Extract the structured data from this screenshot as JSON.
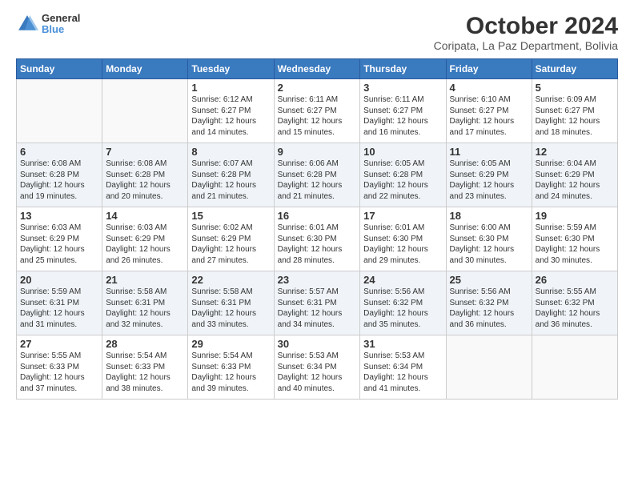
{
  "logo": {
    "text1": "General",
    "text2": "Blue"
  },
  "title": "October 2024",
  "subtitle": "Coripata, La Paz Department, Bolivia",
  "days_of_week": [
    "Sunday",
    "Monday",
    "Tuesday",
    "Wednesday",
    "Thursday",
    "Friday",
    "Saturday"
  ],
  "weeks": [
    [
      {
        "day": "",
        "info": ""
      },
      {
        "day": "",
        "info": ""
      },
      {
        "day": "1",
        "info": "Sunrise: 6:12 AM\nSunset: 6:27 PM\nDaylight: 12 hours and 14 minutes."
      },
      {
        "day": "2",
        "info": "Sunrise: 6:11 AM\nSunset: 6:27 PM\nDaylight: 12 hours and 15 minutes."
      },
      {
        "day": "3",
        "info": "Sunrise: 6:11 AM\nSunset: 6:27 PM\nDaylight: 12 hours and 16 minutes."
      },
      {
        "day": "4",
        "info": "Sunrise: 6:10 AM\nSunset: 6:27 PM\nDaylight: 12 hours and 17 minutes."
      },
      {
        "day": "5",
        "info": "Sunrise: 6:09 AM\nSunset: 6:27 PM\nDaylight: 12 hours and 18 minutes."
      }
    ],
    [
      {
        "day": "6",
        "info": "Sunrise: 6:08 AM\nSunset: 6:28 PM\nDaylight: 12 hours and 19 minutes."
      },
      {
        "day": "7",
        "info": "Sunrise: 6:08 AM\nSunset: 6:28 PM\nDaylight: 12 hours and 20 minutes."
      },
      {
        "day": "8",
        "info": "Sunrise: 6:07 AM\nSunset: 6:28 PM\nDaylight: 12 hours and 21 minutes."
      },
      {
        "day": "9",
        "info": "Sunrise: 6:06 AM\nSunset: 6:28 PM\nDaylight: 12 hours and 21 minutes."
      },
      {
        "day": "10",
        "info": "Sunrise: 6:05 AM\nSunset: 6:28 PM\nDaylight: 12 hours and 22 minutes."
      },
      {
        "day": "11",
        "info": "Sunrise: 6:05 AM\nSunset: 6:29 PM\nDaylight: 12 hours and 23 minutes."
      },
      {
        "day": "12",
        "info": "Sunrise: 6:04 AM\nSunset: 6:29 PM\nDaylight: 12 hours and 24 minutes."
      }
    ],
    [
      {
        "day": "13",
        "info": "Sunrise: 6:03 AM\nSunset: 6:29 PM\nDaylight: 12 hours and 25 minutes."
      },
      {
        "day": "14",
        "info": "Sunrise: 6:03 AM\nSunset: 6:29 PM\nDaylight: 12 hours and 26 minutes."
      },
      {
        "day": "15",
        "info": "Sunrise: 6:02 AM\nSunset: 6:29 PM\nDaylight: 12 hours and 27 minutes."
      },
      {
        "day": "16",
        "info": "Sunrise: 6:01 AM\nSunset: 6:30 PM\nDaylight: 12 hours and 28 minutes."
      },
      {
        "day": "17",
        "info": "Sunrise: 6:01 AM\nSunset: 6:30 PM\nDaylight: 12 hours and 29 minutes."
      },
      {
        "day": "18",
        "info": "Sunrise: 6:00 AM\nSunset: 6:30 PM\nDaylight: 12 hours and 30 minutes."
      },
      {
        "day": "19",
        "info": "Sunrise: 5:59 AM\nSunset: 6:30 PM\nDaylight: 12 hours and 30 minutes."
      }
    ],
    [
      {
        "day": "20",
        "info": "Sunrise: 5:59 AM\nSunset: 6:31 PM\nDaylight: 12 hours and 31 minutes."
      },
      {
        "day": "21",
        "info": "Sunrise: 5:58 AM\nSunset: 6:31 PM\nDaylight: 12 hours and 32 minutes."
      },
      {
        "day": "22",
        "info": "Sunrise: 5:58 AM\nSunset: 6:31 PM\nDaylight: 12 hours and 33 minutes."
      },
      {
        "day": "23",
        "info": "Sunrise: 5:57 AM\nSunset: 6:31 PM\nDaylight: 12 hours and 34 minutes."
      },
      {
        "day": "24",
        "info": "Sunrise: 5:56 AM\nSunset: 6:32 PM\nDaylight: 12 hours and 35 minutes."
      },
      {
        "day": "25",
        "info": "Sunrise: 5:56 AM\nSunset: 6:32 PM\nDaylight: 12 hours and 36 minutes."
      },
      {
        "day": "26",
        "info": "Sunrise: 5:55 AM\nSunset: 6:32 PM\nDaylight: 12 hours and 36 minutes."
      }
    ],
    [
      {
        "day": "27",
        "info": "Sunrise: 5:55 AM\nSunset: 6:33 PM\nDaylight: 12 hours and 37 minutes."
      },
      {
        "day": "28",
        "info": "Sunrise: 5:54 AM\nSunset: 6:33 PM\nDaylight: 12 hours and 38 minutes."
      },
      {
        "day": "29",
        "info": "Sunrise: 5:54 AM\nSunset: 6:33 PM\nDaylight: 12 hours and 39 minutes."
      },
      {
        "day": "30",
        "info": "Sunrise: 5:53 AM\nSunset: 6:34 PM\nDaylight: 12 hours and 40 minutes."
      },
      {
        "day": "31",
        "info": "Sunrise: 5:53 AM\nSunset: 6:34 PM\nDaylight: 12 hours and 41 minutes."
      },
      {
        "day": "",
        "info": ""
      },
      {
        "day": "",
        "info": ""
      }
    ]
  ]
}
